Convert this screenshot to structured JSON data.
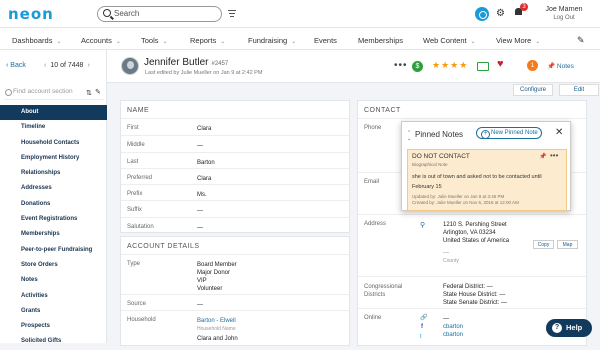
{
  "app": {
    "logo": "neon",
    "search_placeholder": "Search",
    "user_name": "Joe Marnen",
    "logout": "Log Out",
    "notif_count": "3"
  },
  "nav": [
    "Dashboards",
    "Accounts",
    "Tools",
    "Reports",
    "Fundraising",
    "Events",
    "Memberships",
    "Web Content",
    "View More"
  ],
  "sidebar": {
    "back": "Back",
    "page": "10 of 7448",
    "prev": "‹",
    "next": "›",
    "find_placeholder": "Find account section",
    "sections": [
      "About",
      "Timeline",
      "Household Contacts",
      "Employment History",
      "Relationships",
      "Addresses",
      "Donations",
      "Event Registrations",
      "Memberships",
      "Peer-to-peer Fundraising",
      "Store Orders",
      "Notes",
      "Activities",
      "Grants",
      "Prospects",
      "Solicited Gifts"
    ]
  },
  "header": {
    "name": "Jennifer Butler",
    "id": "#2457",
    "edited": "Last edited by Julie Mueller on Jan 9 at 2:42 PM",
    "notes_label": "Notes",
    "notes_count": "1",
    "configure": "Configure",
    "edit": "Edit",
    "stars": "★★★★"
  },
  "name_panel": {
    "title": "NAME",
    "rows": [
      {
        "label": "First",
        "value": "Clara"
      },
      {
        "label": "Middle",
        "value": "—"
      },
      {
        "label": "Last",
        "value": "Barton"
      },
      {
        "label": "Preferred",
        "value": "Clara"
      },
      {
        "label": "Prefix",
        "value": "Ms."
      },
      {
        "label": "Suffix",
        "value": "—"
      },
      {
        "label": "Salutation",
        "value": "—"
      }
    ]
  },
  "account_panel": {
    "title": "ACCOUNT DETAILS",
    "type_label": "Type",
    "types": [
      "Board Member",
      "Major Donor",
      "VIP",
      "Volunteer"
    ],
    "source_label": "Source",
    "source_value": "—",
    "household_label": "Household",
    "household_link": "Barton - Elwell",
    "household_sub": "Household Name",
    "household_addressee": "Clara and John"
  },
  "contact_panel": {
    "title": "CONTACT",
    "phone_label": "Phone",
    "email_label": "Email",
    "address_label": "Address",
    "address_lines": [
      "1210 S. Pershing Street",
      "Arlington, VA 03234",
      "United States of America"
    ],
    "address_county": "—",
    "county_label": "County",
    "copy": "Copy",
    "map": "Map",
    "districts_label": "Congressional Districts",
    "districts": [
      "Federal District: —",
      "State House District: —",
      "State Senate District: —"
    ],
    "online_label": "Online",
    "online": [
      "—",
      "cbarton",
      "cbarton"
    ]
  },
  "pinned_notes": {
    "title": "Pinned Notes",
    "new_button": "New Pinned Note",
    "note_title": "DO NOT CONTACT",
    "note_type": "Biographical Note",
    "note_body": "she is out of town and asked not to be contacted until February 15",
    "updated": "Updated by: Julie Mueller on Jan 9 at 3:45 PM",
    "created": "Created by: Julie Mueller on Nov 6, 2018 at 12:00 AM"
  },
  "help": "Help"
}
